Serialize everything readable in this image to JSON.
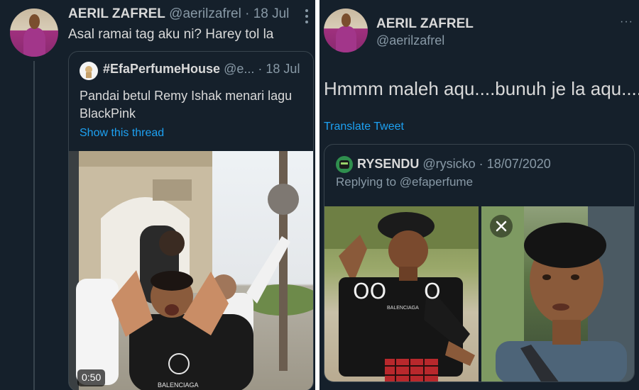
{
  "left_tweet": {
    "author_name": "AERIL ZAFREL",
    "handle": "@aerilzafrel",
    "sep": "·",
    "date": "18 Jul",
    "text": "Asal ramai tag aku ni? Harey tol la",
    "quoted": {
      "author_name": "#EfaPerfumeHouse",
      "handle": "@e...",
      "sep": "·",
      "date": "18 Jul",
      "text_line1": "Pandai betul Remy Ishak menari lagu",
      "text_line2": "BlackPink",
      "show_thread": "Show this thread",
      "video_duration": "0:50",
      "video_shirt_text": "BALENCIAGA"
    }
  },
  "right_tweet": {
    "author_name": "AERIL ZAFREL",
    "handle": "@aerilzafrel",
    "more": "···",
    "text": "Hmmm maleh aqu....bunuh je la aqu....",
    "translate": "Translate Tweet",
    "quoted": {
      "author_name": "RYSENDU",
      "handle": "@rysicko",
      "sep": "·",
      "date": "18/07/2020",
      "replying_to_label": "Replying to",
      "replying_to_handle": "@efaperfume",
      "image1_text": "BALENCIAGA"
    }
  },
  "colors": {
    "background": "#15202b",
    "text": "#d9d9d9",
    "muted": "#8899a6",
    "accent": "#1da1f2",
    "border": "#38444d"
  }
}
